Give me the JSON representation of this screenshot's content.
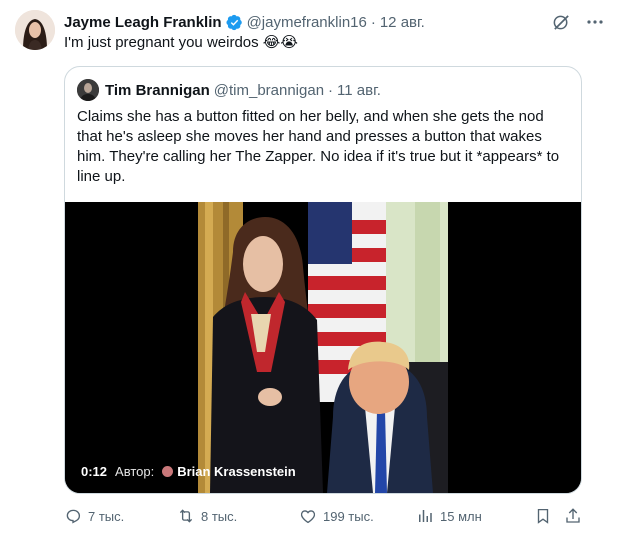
{
  "author": {
    "name": "Jayme Leagh Franklin",
    "handle": "@jaymefranklin16",
    "separator": "·",
    "date": "12 авг.",
    "text": "I'm just pregnant you weirdos 😂😭"
  },
  "header_icons": [
    "grok-slash-icon",
    "more-icon"
  ],
  "quote": {
    "name": "Tim Brannigan",
    "handle": "@tim_brannigan",
    "separator": "·",
    "date": "11 авг.",
    "text": "Claims she has a button fitted on her belly, and when she gets the nod that he's asleep she moves her hand and presses a button that wakes him. They're calling her The Zapper. No idea if it's true but it *appears* to line up.",
    "video": {
      "time": "0:12",
      "author_label": "Автор:",
      "author_name": "Brian Krassenstein"
    }
  },
  "actions": {
    "replies": "7 тыс.",
    "reposts": "8 тыс.",
    "likes": "199 тыс.",
    "views": "15 млн"
  },
  "colors": {
    "text": "#0f1419",
    "secondary": "#536471",
    "verified": "#1d9bf0",
    "border": "#cfd9de"
  }
}
